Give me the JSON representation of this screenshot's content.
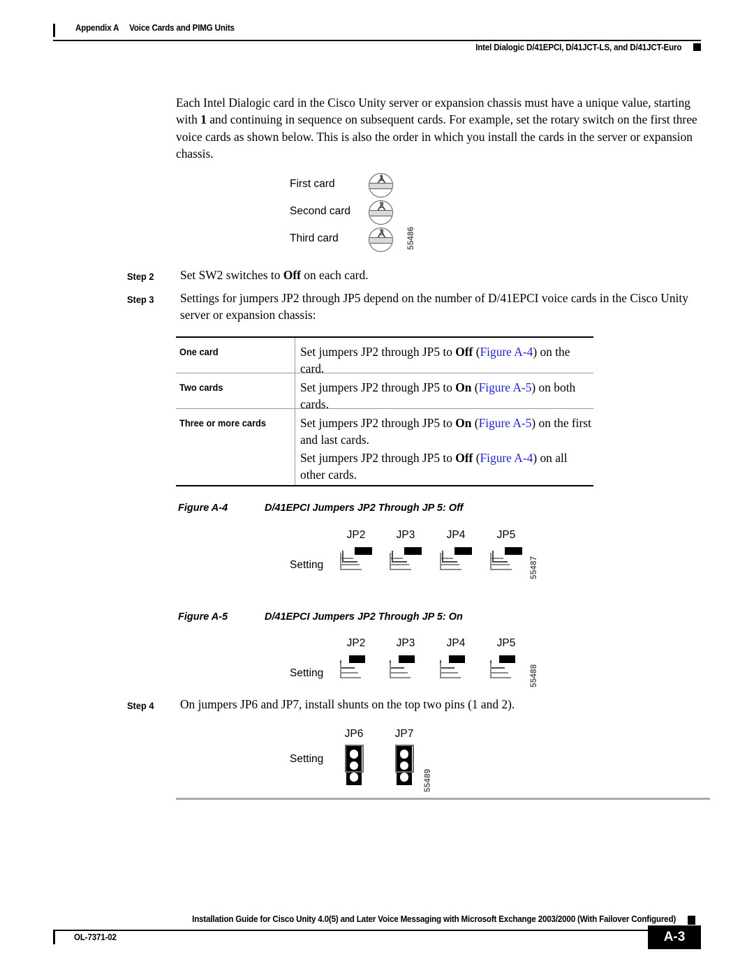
{
  "header": {
    "appendix": "Appendix A",
    "section": "Voice Cards and PIMG Units",
    "topic": "Intel Dialogic D/41EPCI, D/41JCT-LS, and D/41JCT-Euro"
  },
  "intro": {
    "text_before_bold": "Each Intel Dialogic card in the Cisco Unity server or expansion chassis must have a unique value, starting with ",
    "bold": "1",
    "text_after_bold": " and continuing in sequence on subsequent cards. For example, set the rotary switch on the first three voice cards as shown below. This is also the order in which you install the cards in the server or expansion chassis."
  },
  "rotary_figure": {
    "id": "55486",
    "rows": [
      {
        "label": "First card",
        "digit": "1"
      },
      {
        "label": "Second card",
        "digit": "2"
      },
      {
        "label": "Third card",
        "digit": "3"
      }
    ]
  },
  "steps": {
    "step2": {
      "num": "Step 2",
      "before": "Set SW2 switches to ",
      "bold": "Off",
      "after": " on each card."
    },
    "step3": {
      "num": "Step 3",
      "text": "Settings for jumpers JP2 through JP5 depend on the number of D/41EPCI voice cards in the Cisco Unity server or expansion chassis:"
    },
    "step4": {
      "num": "Step 4",
      "text": "On jumpers JP6 and JP7, install shunts on the top two pins (1 and 2)."
    }
  },
  "jumper_table": {
    "rows": [
      {
        "term": "One card",
        "lines": [
          {
            "pre": "Set jumpers JP2 through JP5 to ",
            "bold": "Off",
            "mid": " (",
            "xref": "Figure A-4",
            "post": ") on the card."
          }
        ]
      },
      {
        "term": "Two cards",
        "lines": [
          {
            "pre": "Set jumpers JP2 through JP5 to ",
            "bold": "On",
            "mid": " (",
            "xref": "Figure A-5",
            "post": ") on both cards."
          }
        ]
      },
      {
        "term": "Three or more cards",
        "lines": [
          {
            "pre": "Set jumpers JP2 through JP5 to ",
            "bold": "On",
            "mid": " (",
            "xref": "Figure A-5",
            "post": ") on the first and last cards."
          },
          {
            "pre": "Set jumpers JP2 through JP5 to ",
            "bold": "Off",
            "mid": " (",
            "xref": "Figure A-4",
            "post": ") on all other cards."
          }
        ]
      }
    ]
  },
  "figure_a4": {
    "number": "Figure A-4",
    "title": "D/41EPCI Jumpers JP2 Through JP 5: Off",
    "id": "55487",
    "setting_label": "Setting",
    "state": "off",
    "columns": [
      "JP2",
      "JP3",
      "JP4",
      "JP5"
    ]
  },
  "figure_a5": {
    "number": "Figure A-5",
    "title": "D/41EPCI Jumpers JP2 Through JP 5: On",
    "id": "55488",
    "setting_label": "Setting",
    "state": "on",
    "columns": [
      "JP2",
      "JP3",
      "JP4",
      "JP5"
    ]
  },
  "figure_jp67": {
    "id": "55489",
    "setting_label": "Setting",
    "columns": [
      "JP6",
      "JP7"
    ],
    "pins": 3,
    "shunt_pins": "1 and 2"
  },
  "footer": {
    "guide": "Installation Guide for Cisco Unity 4.0(5) and Later Voice Messaging with Microsoft Exchange 2003/2000 (With Failover Configured)",
    "doc_id": "OL-7371-02",
    "page": "A-3"
  },
  "colors": {
    "xref_blue": "#2323cc",
    "rule_gray": "#a8a8aa",
    "switch_gray": "#58595b"
  }
}
